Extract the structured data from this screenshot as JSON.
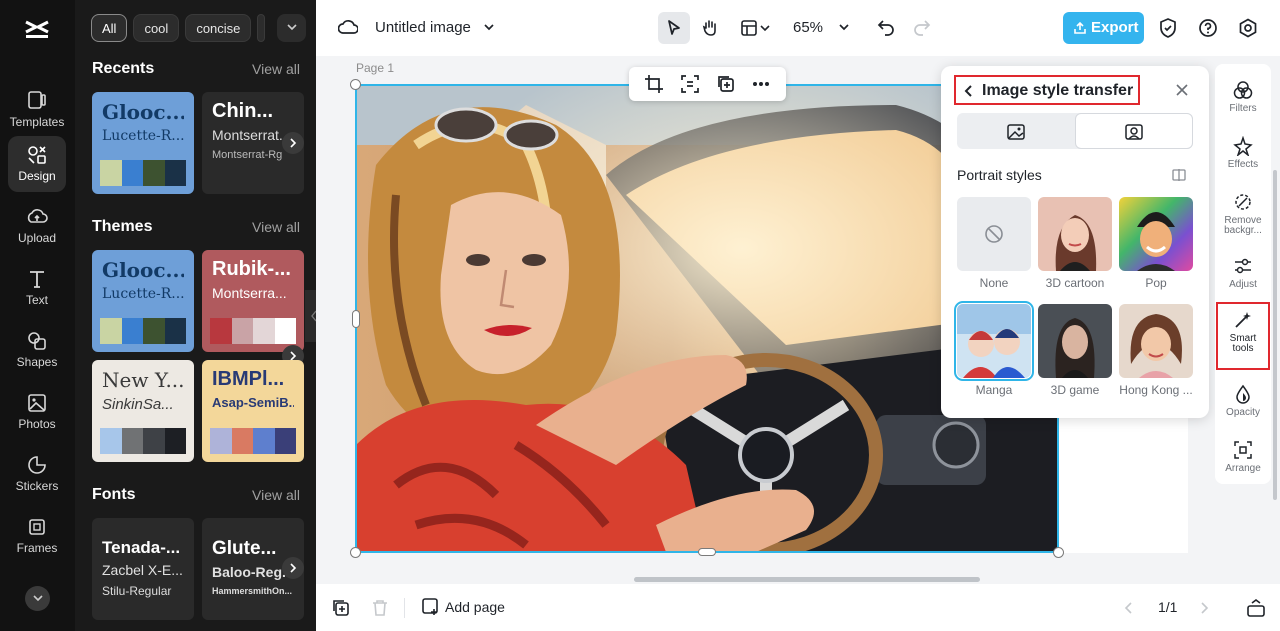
{
  "rail": {
    "items": [
      {
        "label": "Templates",
        "icon": "templates-icon"
      },
      {
        "label": "Design",
        "icon": "design-icon"
      },
      {
        "label": "Upload",
        "icon": "upload-icon"
      },
      {
        "label": "Text",
        "icon": "text-icon"
      },
      {
        "label": "Shapes",
        "icon": "shapes-icon"
      },
      {
        "label": "Photos",
        "icon": "photos-icon"
      },
      {
        "label": "Stickers",
        "icon": "stickers-icon"
      },
      {
        "label": "Frames",
        "icon": "frames-icon"
      }
    ]
  },
  "panel": {
    "chips": [
      "All",
      "cool",
      "concise"
    ],
    "recents": {
      "title": "Recents",
      "view_all": "View all",
      "cards": [
        {
          "t1": "Glooc...",
          "t2": "Lucette-R...",
          "colors": [
            "#c9d4a3",
            "#3a7fd0",
            "#3d5230",
            "#1a3147"
          ]
        },
        {
          "t1": "Chin...",
          "t2": "Montserrat...",
          "t3": "Montserrat-Rg"
        }
      ]
    },
    "themes": {
      "title": "Themes",
      "view_all": "View all",
      "cards": [
        {
          "t1": "Glooc...",
          "t2": "Lucette-R..."
        },
        {
          "t1": "Rubik-...",
          "t2": "Montserra..."
        },
        {
          "t1": "New Y...",
          "t2": "SinkinSa..."
        },
        {
          "t1": "IBMPl...",
          "t2": "Asap-SemiB..."
        }
      ]
    },
    "fonts": {
      "title": "Fonts",
      "view_all": "View all",
      "cards": [
        {
          "t1": "Tenada-...",
          "t2": "Zacbel X-E...",
          "t3": "Stilu-Regular"
        },
        {
          "t1": "Glute...",
          "t2": "Baloo-Reg...",
          "t3": "HammersmithOn..."
        }
      ]
    }
  },
  "topbar": {
    "title": "Untitled image",
    "zoom": "65%",
    "export": "Export"
  },
  "canvas": {
    "page_label": "Page 1"
  },
  "popup": {
    "title": "Image style transfer",
    "section": "Portrait styles",
    "styles": [
      "None",
      "3D cartoon",
      "Pop",
      "Manga",
      "3D game",
      "Hong Kong ..."
    ],
    "selected": "Manga"
  },
  "right_tools": [
    {
      "label1": "Filters",
      "label2": ""
    },
    {
      "label1": "Effects",
      "label2": ""
    },
    {
      "label1": "Remove",
      "label2": "backgr..."
    },
    {
      "label1": "Adjust",
      "label2": ""
    },
    {
      "label1": "Smart",
      "label2": "tools"
    },
    {
      "label1": "Opacity",
      "label2": ""
    },
    {
      "label1": "Arrange",
      "label2": ""
    }
  ],
  "bottombar": {
    "add_page": "Add page",
    "page_count": "1/1"
  },
  "colors": {
    "accent": "#34b4ee",
    "highlight": "#e0282e",
    "selection": "#2fb5e8",
    "rail_bg": "#121212",
    "panel_bg": "#1a1a1a"
  }
}
